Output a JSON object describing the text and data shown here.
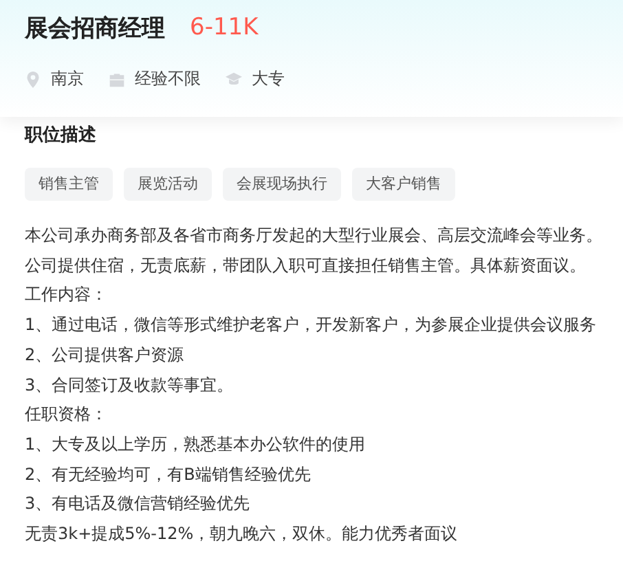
{
  "job": {
    "title": "展会招商经理",
    "salary": "6-11K"
  },
  "meta": [
    {
      "kind": "location",
      "text": "南京"
    },
    {
      "kind": "experience",
      "text": "经验不限"
    },
    {
      "kind": "education",
      "text": "大专"
    }
  ],
  "section_title": "职位描述",
  "tags": [
    "销售主管",
    "展览活动",
    "会展现场执行",
    "大客户销售"
  ],
  "description": [
    "本公司承办商务部及各省市商务厅发起的大型行业展会、高层交流峰会等业务。",
    "公司提供住宿，无责底薪，带团队入职可直接担任销售主管。具体薪资面议。",
    "工作内容：",
    "1、通过电话，微信等形式维护老客户，开发新客户，为参展企业提供会议服务",
    "2、公司提供客户资源",
    "3、合同签订及收款等事宜。",
    "任职资格：",
    "1、大专及以上学历，熟悉基本办公软件的使用",
    "2、有无经验均可，有B端销售经验优先",
    "3、有电话及微信营销经验优先",
    "无责3k+提成5%-12%，朝九晚六，双休。能力优秀者面议"
  ]
}
